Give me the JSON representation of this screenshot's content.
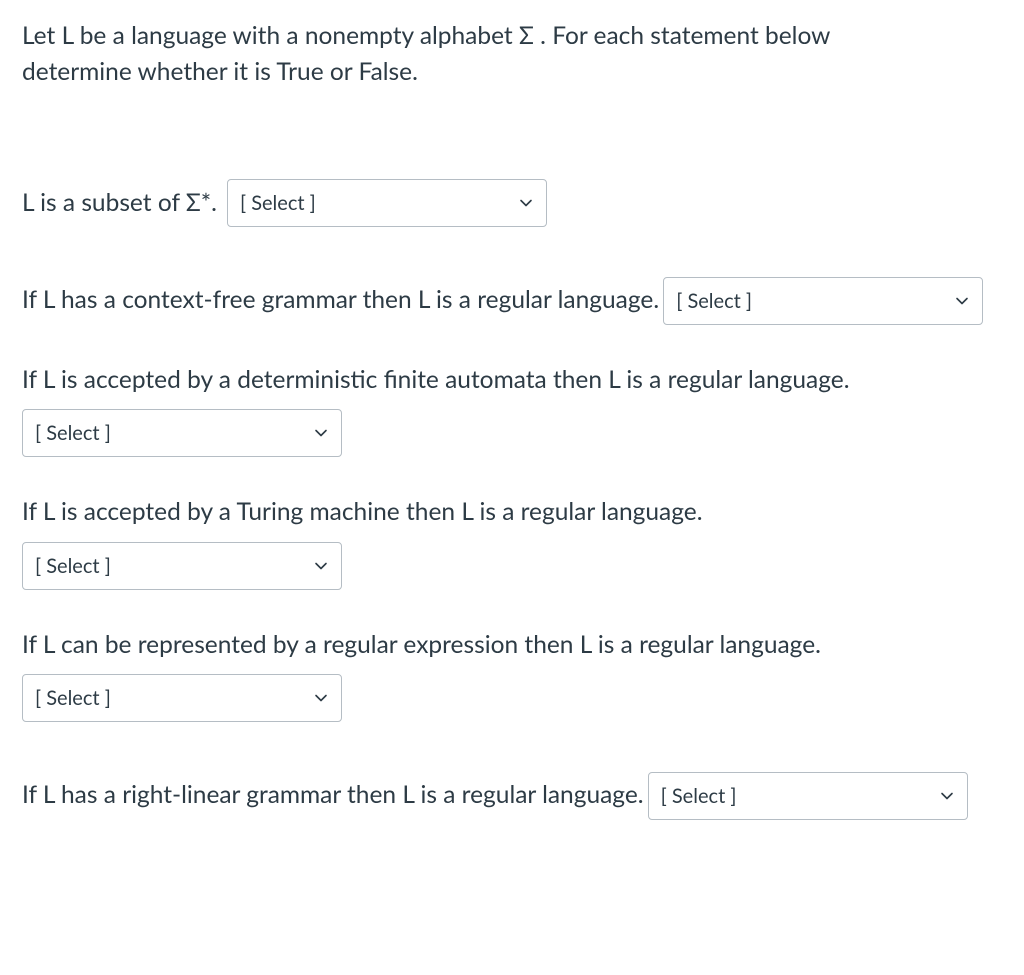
{
  "prompt_line1": "Let L be a language with a nonempty alphabet Σ .  For each statement below",
  "prompt_line2": "determine whether it is True or False.",
  "select_placeholder": "[ Select ]",
  "questions": {
    "q1": {
      "text": "L is a subset of Σ*."
    },
    "q2": {
      "text": "If L has a context-free grammar then L is a regular language."
    },
    "q3": {
      "text": "If L is  accepted by a deterministic finite automata then L is a regular language."
    },
    "q4": {
      "text": "If L is  accepted by a Turing machine then  L is a regular language."
    },
    "q5": {
      "text": "If L can be represented by a regular expression then L is a regular language."
    },
    "q6": {
      "text": "If L has a right-linear grammar then L is a regular language."
    }
  }
}
